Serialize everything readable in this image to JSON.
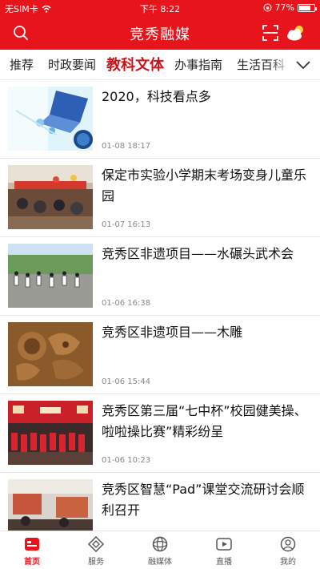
{
  "status_bar": {
    "carrier": "无SIM卡",
    "time": "下午 8:22",
    "battery_percent": "77%",
    "battery_level": 0.77
  },
  "app_bar": {
    "title": "竞秀融媒",
    "search_icon": "search-icon",
    "scan_icon": "scan-icon",
    "weather_icon": "weather-icon"
  },
  "tabs": [
    {
      "label": "推荐",
      "active": false
    },
    {
      "label": "时政要闻",
      "active": false
    },
    {
      "label": "教科文体",
      "active": true
    },
    {
      "label": "办事指南",
      "active": false
    },
    {
      "label": "生活百科",
      "active": false
    }
  ],
  "tabs_more_icon": "chevron-down-icon",
  "articles": [
    {
      "title": "2020，科技看点多",
      "date": "01-08 18:17",
      "image": "tech-laptop"
    },
    {
      "title": "保定市实验小学期末考场变身儿童乐园",
      "date": "01-07 16:13",
      "image": "classroom"
    },
    {
      "title": "竞秀区非遗项目——水碾头武术会",
      "date": "01-06 16:38",
      "image": "martial-arts"
    },
    {
      "title": "竞秀区非遗项目——木雕",
      "date": "01-06 15:44",
      "image": "wood-carving"
    },
    {
      "title": "竞秀区第三届“七中杯”校园健美操、啦啦操比赛”精彩纷呈",
      "date": "01-06 10:23",
      "image": "cheerleading"
    },
    {
      "title": "竞秀区智慧“Pad”课堂交流研讨会顺利召开",
      "date": "",
      "image": "seminar"
    }
  ],
  "bottom_nav": [
    {
      "label": "首页",
      "icon": "home-icon",
      "active": true
    },
    {
      "label": "服务",
      "icon": "service-icon",
      "active": false
    },
    {
      "label": "融媒体",
      "icon": "media-icon",
      "active": false
    },
    {
      "label": "直播",
      "icon": "live-icon",
      "active": false
    },
    {
      "label": "我的",
      "icon": "profile-icon",
      "active": false
    }
  ],
  "colors": {
    "brand_red": "#e8141b",
    "active_tab": "#c8151b"
  }
}
